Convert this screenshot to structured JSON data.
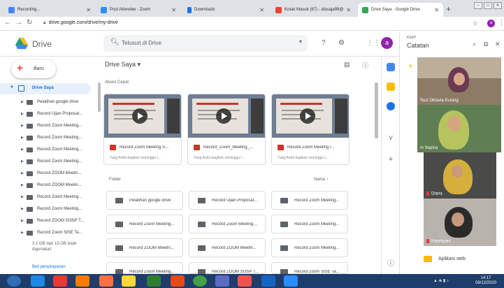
{
  "browser": {
    "tabs": [
      {
        "title": "Recording...",
        "color": "#4285f4"
      },
      {
        "title": "Post Attendee - Zoom",
        "color": "#2d8cff"
      },
      {
        "title": "Downloads",
        "color": "#1a73e8"
      },
      {
        "title": "Kotak Masuk (67) - afasaja99@",
        "color": "#ea4335"
      },
      {
        "title": "Drive Saya - Google Drive",
        "color": "#34a853"
      }
    ],
    "url": "drive.google.com/drive/my-drive",
    "profile_initial": "a"
  },
  "drive": {
    "title": "Drive",
    "search_placeholder": "Telusuri di Drive",
    "avatar_initial": "a",
    "new_button": "Baru",
    "my_drive": "Drive Saya",
    "tree": [
      "Pelatihan google drive",
      "Record Ujian Proposal...",
      "Record Zoom Meeting...",
      "Record Zoom Meeting...",
      "Record Zoom Meeting...",
      "Record Zoom Meeting...",
      "Record ZOOM Meetin...",
      "Record ZOOM Meetin...",
      "Record Zoom Meeting...",
      "Record Zoom Meeting...",
      "Record ZOOM SI3SP T...",
      "Record Zoom SISE Ta..."
    ],
    "storage": "3,1 GB dari 15 GB telah digunakan",
    "buy_storage": "Beli penyimpanan",
    "breadcrumb": "Drive Saya",
    "quick_access_title": "Akses Cepat",
    "quick_access": [
      {
        "name": "Record Zoom Meeting S...",
        "sub": "Yang Anda bagikan seminggu l..."
      },
      {
        "name": "Record_Zoom_Meeting_...",
        "sub": "Yang Anda bagikan seminggu l..."
      },
      {
        "name": "Record Zoom Meeting I...",
        "sub": "Yang Anda bagikan seminggu l..."
      }
    ],
    "folder_title": "Folder",
    "sort_label": "Nama",
    "folders": [
      "Pelatihan google drive",
      "Record Ujian Proposal...",
      "Record Zoom Meeting...",
      "Record Zoom Meeting...",
      "Record Zoom Meeting...",
      "Record Zoom Meeting...",
      "Record ZOOM Meetin...",
      "Record ZOOM Meetin...",
      "Record Zoom Meeting...",
      "Record Zoom Meeting...",
      "Record ZOOM SI3SP T...",
      "Record Zoom SISE Ta..."
    ]
  },
  "keep": {
    "label": "KEEP",
    "title": "Catatan",
    "apps_label": "Aplikasi web"
  },
  "video_participants": [
    {
      "name": "Suzi Oktavia Kurang"
    },
    {
      "name": "In Sepina"
    },
    {
      "name": "Diana"
    },
    {
      "name": "Kasmiyani"
    }
  ],
  "taskbar": {
    "time": "14:17",
    "date": "08/12/2020"
  }
}
